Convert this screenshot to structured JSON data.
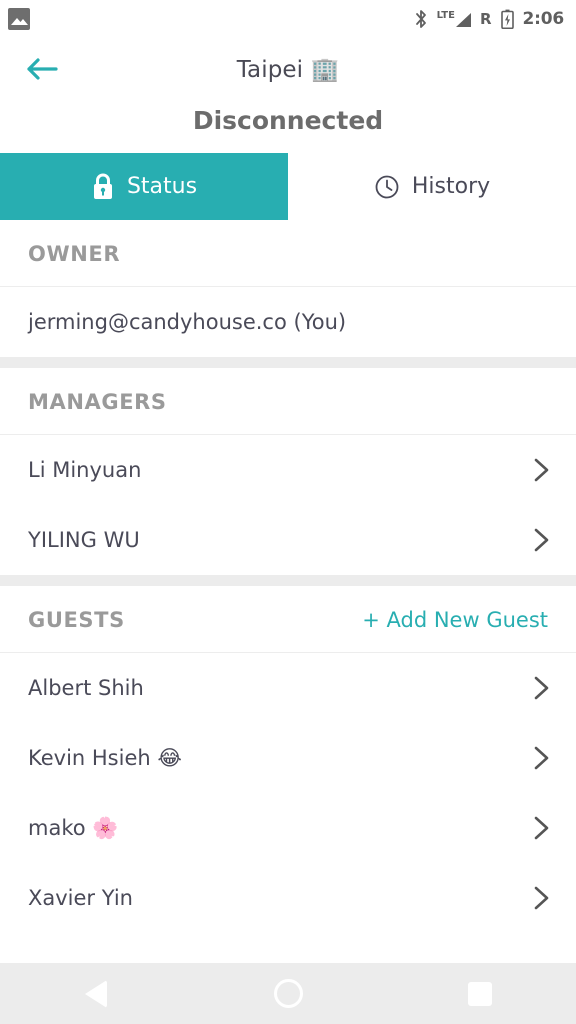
{
  "status_bar": {
    "gallery_icon": "gallery-icon",
    "bluetooth_icon": "bluetooth-icon",
    "network_type": "LTE",
    "signal_icon": "signal-bars-icon",
    "roaming_label": "R",
    "battery_icon": "battery-charging-icon",
    "time": "2:06"
  },
  "titlebar": {
    "back_icon": "back-arrow-icon",
    "title": "Taipei 🏢"
  },
  "connection": {
    "status": "Disconnected"
  },
  "tabs": [
    {
      "label": "Status",
      "icon": "lock-icon",
      "active": true
    },
    {
      "label": "History",
      "icon": "clock-icon",
      "active": false
    }
  ],
  "sections": [
    {
      "title": "OWNER",
      "action": null,
      "rows": [
        {
          "label": "jerming@candyhouse.co (You)",
          "chevron": false
        }
      ]
    },
    {
      "title": "MANAGERS",
      "action": null,
      "rows": [
        {
          "label": "Li Minyuan",
          "chevron": true
        },
        {
          "label": "YILING WU",
          "chevron": true
        }
      ]
    },
    {
      "title": "GUESTS",
      "action": "+ Add New Guest",
      "rows": [
        {
          "label": "Albert Shih",
          "chevron": true
        },
        {
          "label": "Kevin Hsieh 😂",
          "chevron": true
        },
        {
          "label": "mako 🌸",
          "chevron": true
        },
        {
          "label": "Xavier Yin",
          "chevron": true
        }
      ]
    }
  ],
  "navbar": {
    "back": "nav-back-icon",
    "home": "nav-home-icon",
    "recents": "nav-recents-icon"
  },
  "colors": {
    "accent": "#28aeb1",
    "band": "#ececec",
    "text": "#4a4a58",
    "muted": "#9a9a9a"
  }
}
